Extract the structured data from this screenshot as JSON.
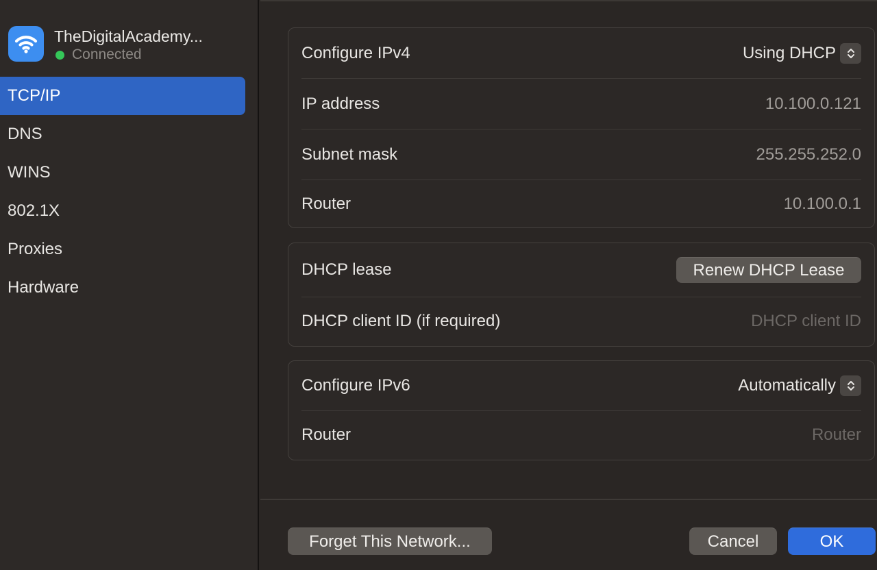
{
  "network": {
    "name": "TheDigitalAcademy...",
    "status": "Connected",
    "status_color": "#35c759",
    "icon": "wifi-icon"
  },
  "sidebar": {
    "items": [
      {
        "label": "TCP/IP",
        "active": true
      },
      {
        "label": "DNS",
        "active": false
      },
      {
        "label": "WINS",
        "active": false
      },
      {
        "label": "802.1X",
        "active": false
      },
      {
        "label": "Proxies",
        "active": false
      },
      {
        "label": "Hardware",
        "active": false
      }
    ]
  },
  "ipv4": {
    "configure_label": "Configure IPv4",
    "configure_value": "Using DHCP",
    "ip_label": "IP address",
    "ip_value": "10.100.0.121",
    "subnet_label": "Subnet mask",
    "subnet_value": "255.255.252.0",
    "router_label": "Router",
    "router_value": "10.100.0.1"
  },
  "dhcp": {
    "lease_label": "DHCP lease",
    "renew_button": "Renew DHCP Lease",
    "client_id_label": "DHCP client ID (if required)",
    "client_id_placeholder": "DHCP client ID"
  },
  "ipv6": {
    "configure_label": "Configure IPv6",
    "configure_value": "Automatically",
    "router_label": "Router",
    "router_placeholder": "Router"
  },
  "footer": {
    "forget_button": "Forget This Network...",
    "cancel_button": "Cancel",
    "ok_button": "OK"
  },
  "colors": {
    "accent": "#2f6cdc",
    "sidebar_selection": "#2f65c4",
    "wifi_tile": "#3d8ef0"
  }
}
